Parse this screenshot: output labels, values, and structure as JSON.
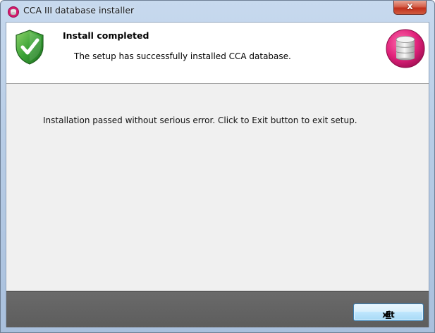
{
  "window": {
    "title": "CCA III database installer",
    "close_label": "x"
  },
  "header": {
    "title": "Install completed",
    "subtitle": "The setup has successfully installed CCA database."
  },
  "main": {
    "message": "Installation passed without serious error. Click to Exit button to exit setup."
  },
  "footer": {
    "exit_mnemonic": "E",
    "exit_rest": "xit"
  },
  "icons": {
    "app": "database-icon",
    "header_left": "shield-check-icon",
    "header_right": "database-logo-icon"
  },
  "colors": {
    "accent_pink": "#e0217a",
    "shield_green": "#2f9a2f",
    "footer_gray": "#5f5f5f"
  }
}
